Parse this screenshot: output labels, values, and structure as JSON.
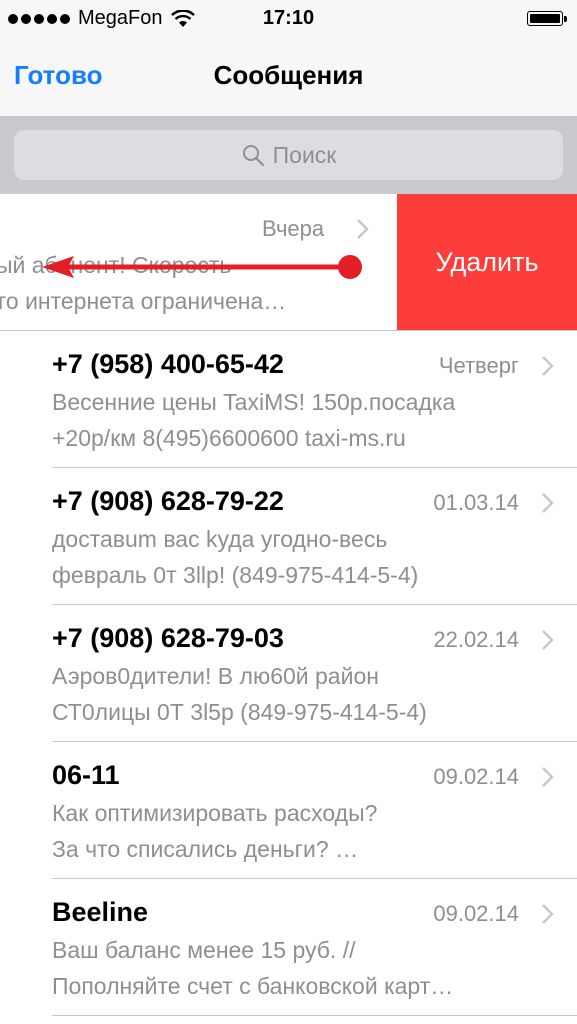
{
  "status": {
    "carrier": "MegaFon",
    "time": "17:10"
  },
  "nav": {
    "done": "Готово",
    "title": "Сообщения"
  },
  "search": {
    "placeholder": "Поиск"
  },
  "swiped": {
    "date": "Вчера",
    "line1": "ый абонент! Скорость",
    "line2": "го интернета ограничена…",
    "delete": "Удалить"
  },
  "messages": [
    {
      "name": "+7 (958) 400-65-42",
      "date": "Четверг",
      "line1": "Весенние цены TaxiMS! 150р.посадка",
      "line2": "+20р/км 8(495)6600600 taxi-ms.ru"
    },
    {
      "name": "+7 (908) 628-79-22",
      "date": "01.03.14",
      "line1": "доставum вас kуда yгодно-весь",
      "line2": "февраль 0т 3llр! (849-975-414-5-4)"
    },
    {
      "name": "+7 (908) 628-79-03",
      "date": "22.02.14",
      "line1": "Аэров0дители! В лю60й район",
      "line2": "СТ0лицы 0Т 3l5р (849-975-414-5-4)"
    },
    {
      "name": "06-11",
      "date": "09.02.14",
      "line1": "Как оптимизировать расходы?",
      "line2": "За что списались деньги? …"
    },
    {
      "name": "Beeline",
      "date": "09.02.14",
      "line1": "Ваш баланс менее 15 руб. //",
      "line2": "Пополняйте счет с банковской карт…"
    }
  ]
}
